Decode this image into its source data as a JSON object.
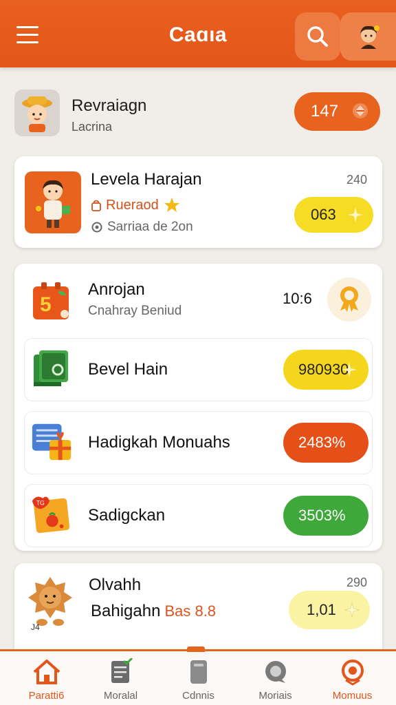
{
  "header": {
    "title": "Caɑıa",
    "menu_icon": "hamburger-icon",
    "search_icon": "search-icon",
    "avatar_icon": "user-avatar-icon",
    "accent": "#e4561a"
  },
  "profile": {
    "name": "Revraiagn",
    "subtitle": "Lacrina",
    "pill_value": "147",
    "pill_color": "#e8641e"
  },
  "level_card": {
    "title": "Levela Harajan",
    "subtitle": "Rueraod",
    "meta": "Sarriaa de 2on",
    "count": "240",
    "pill_value": "063"
  },
  "list": [
    {
      "title": "Anrojan",
      "subtitle": "Cnahray Beniud",
      "value": "10:6",
      "icon": "calendar-5-icon"
    },
    {
      "title": "Bevel Hain",
      "pill_value": "980930",
      "pill_color": "#f6d61c",
      "icon": "book-icon"
    },
    {
      "title": "Hadigkah Monuahs",
      "pill_value": "2483%",
      "pill_color": "#e55019",
      "icon": "gift-icon"
    },
    {
      "title": "Sadigckan",
      "pill_value": "3503%",
      "pill_color": "#3fa83a",
      "icon": "fruit-card-icon"
    }
  ],
  "bottom_card": {
    "title": "Olvahh",
    "subtitle": "Bahigahn",
    "accent_text": "Bas 8.8",
    "count": "290",
    "pill_value": "1,01",
    "tiny_label": "J4"
  },
  "nav": [
    {
      "label": "Paratti6",
      "icon": "home-icon",
      "active": true
    },
    {
      "label": "Moralal",
      "icon": "checklist-icon",
      "active": false
    },
    {
      "label": "Cdnnis",
      "icon": "document-icon",
      "active": false
    },
    {
      "label": "Moriais",
      "icon": "chat-icon",
      "active": false
    },
    {
      "label": "Momuus",
      "icon": "target-icon",
      "active": true
    }
  ]
}
